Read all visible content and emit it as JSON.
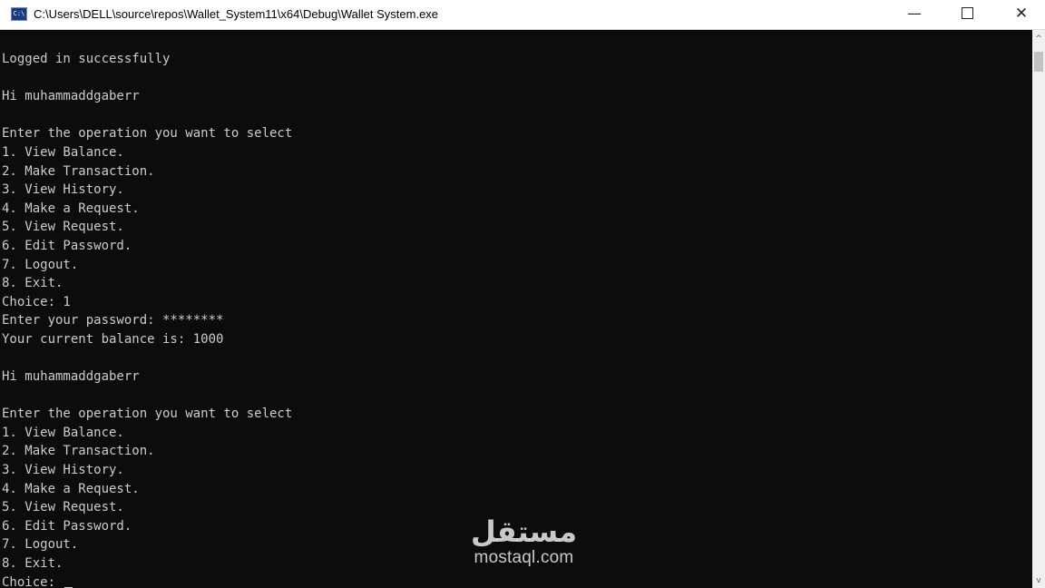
{
  "window": {
    "icon": "console-app-icon",
    "icon_glyph": "C:\\",
    "title": "C:\\Users\\DELL\\source\\repos\\Wallet_System11\\x64\\Debug\\Wallet System.exe",
    "controls": {
      "minimize": "—",
      "close": "✕"
    }
  },
  "console": {
    "lines": [
      "Logged in successfully",
      "",
      "Hi muhammaddgaberr",
      "",
      "Enter the operation you want to select",
      "1. View Balance.",
      "2. Make Transaction.",
      "3. View History.",
      "4. Make a Request.",
      "5. View Request.",
      "6. Edit Password.",
      "7. Logout.",
      "8. Exit.",
      "Choice: 1",
      "Enter your password: ********",
      "Your current balance is: 1000",
      "",
      "Hi muhammaddgaberr",
      "",
      "Enter the operation you want to select",
      "1. View Balance.",
      "2. Make Transaction.",
      "3. View History.",
      "4. Make a Request.",
      "5. View Request.",
      "6. Edit Password.",
      "7. Logout.",
      "8. Exit.",
      "Choice: "
    ]
  },
  "scrollbar": {
    "up_arrow": "^",
    "down_arrow": "v"
  },
  "watermark": {
    "logo_text": "مستقل",
    "domain": "mostaql.com"
  }
}
